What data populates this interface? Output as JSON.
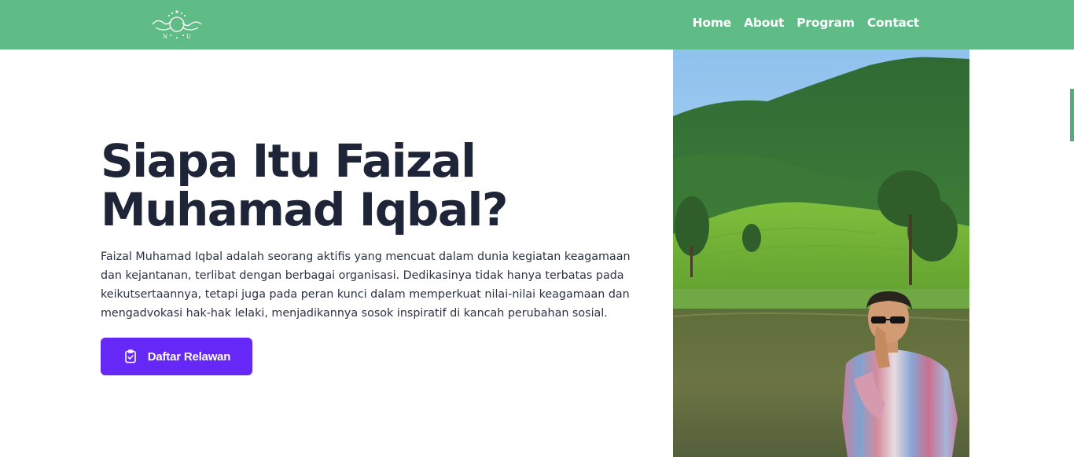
{
  "colors": {
    "nav_bg": "#60bc86",
    "cta_bg": "#6528f7",
    "title_color": "#1f2538",
    "scroll_indicator": "#4fb07a"
  },
  "header": {
    "logo_icon": "nahdlatul-ulama-logo",
    "nav": [
      {
        "label": "Home"
      },
      {
        "label": "About"
      },
      {
        "label": "Program"
      },
      {
        "label": "Contact"
      }
    ]
  },
  "hero": {
    "title_line1": "Siapa Itu Faizal",
    "title_line2": "Muhamad Iqbal?",
    "description": "Faizal Muhamad Iqbal adalah seorang aktifis yang mencuat dalam dunia kegiatan keagamaan dan kejantanan, terlibat dengan berbagai organisasi. Dedikasinya tidak hanya terbatas pada keikutsertaannya, tetapi juga pada peran kunci dalam memperkuat nilai-nilai keagamaan dan mengadvokasi hak-hak lelaki, menjadikannya sosok inspiratif di kancah perubahan sosial.",
    "cta_label": "Daftar Relawan",
    "cta_icon": "clipboard-check-icon",
    "image_subject": "portrait-photo-tea-plantation-lake"
  }
}
